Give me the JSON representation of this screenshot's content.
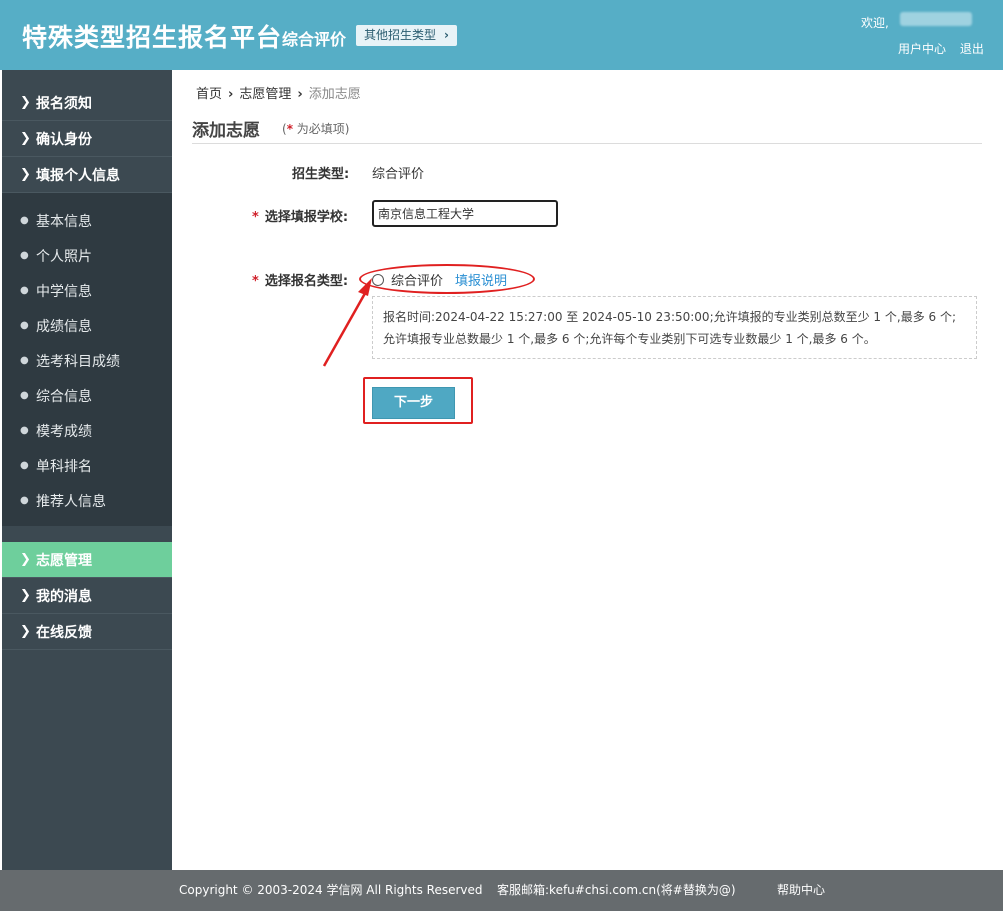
{
  "header": {
    "title": "特殊类型招生报名平台",
    "subtitle": "综合评价",
    "other_types_label": "其他招生类型",
    "welcome": "欢迎,",
    "user_center": "用户中心",
    "logout": "退出",
    "bg_color": "#56aec6"
  },
  "sidebar": {
    "top_items": [
      {
        "label": "报名须知"
      },
      {
        "label": "确认身份"
      },
      {
        "label": "填报个人信息"
      }
    ],
    "sub_items": [
      {
        "label": "基本信息"
      },
      {
        "label": "个人照片"
      },
      {
        "label": "中学信息"
      },
      {
        "label": "成绩信息"
      },
      {
        "label": "选考科目成绩"
      },
      {
        "label": "综合信息"
      },
      {
        "label": "模考成绩"
      },
      {
        "label": "单科排名"
      },
      {
        "label": "推荐人信息"
      }
    ],
    "bottom_items": [
      {
        "label": "志愿管理",
        "active": true
      },
      {
        "label": "我的消息"
      },
      {
        "label": "在线反馈"
      }
    ],
    "active_color": "#6ecf9c"
  },
  "breadcrumb": {
    "home": "首页",
    "parent": "志愿管理",
    "current": "添加志愿"
  },
  "page": {
    "title": "添加志愿",
    "required_note_open": "(",
    "required_star": "*",
    "required_note_text": " 为必填项)"
  },
  "form": {
    "type_label": "招生类型:",
    "type_value": "综合评价",
    "school_label": "选择填报学校:",
    "school_value": "南京信息工程大学",
    "reg_type_label": "选择报名类型:",
    "reg_type_option": "综合评价",
    "fill_guide_link": "填报说明",
    "info_text": "报名时间:2024-04-22 15:27:00 至 2024-05-10 23:50:00;允许填报的专业类别总数至少 1 个,最多 6 个;允许填报专业总数最少 1 个,最多 6 个;允许每个专业类别下可选专业数最少 1 个,最多 6 个。",
    "next_button": "下一步",
    "required_star": "*"
  },
  "footer": {
    "copyright": "Copyright © 2003-2024 学信网 All Rights Reserved",
    "service_mail": "客服邮箱:kefu#chsi.com.cn(将#替换为@)",
    "help_center": "帮助中心"
  },
  "icons": {
    "chevron": "chevron-right-icon",
    "bullet": "bullet-icon"
  }
}
